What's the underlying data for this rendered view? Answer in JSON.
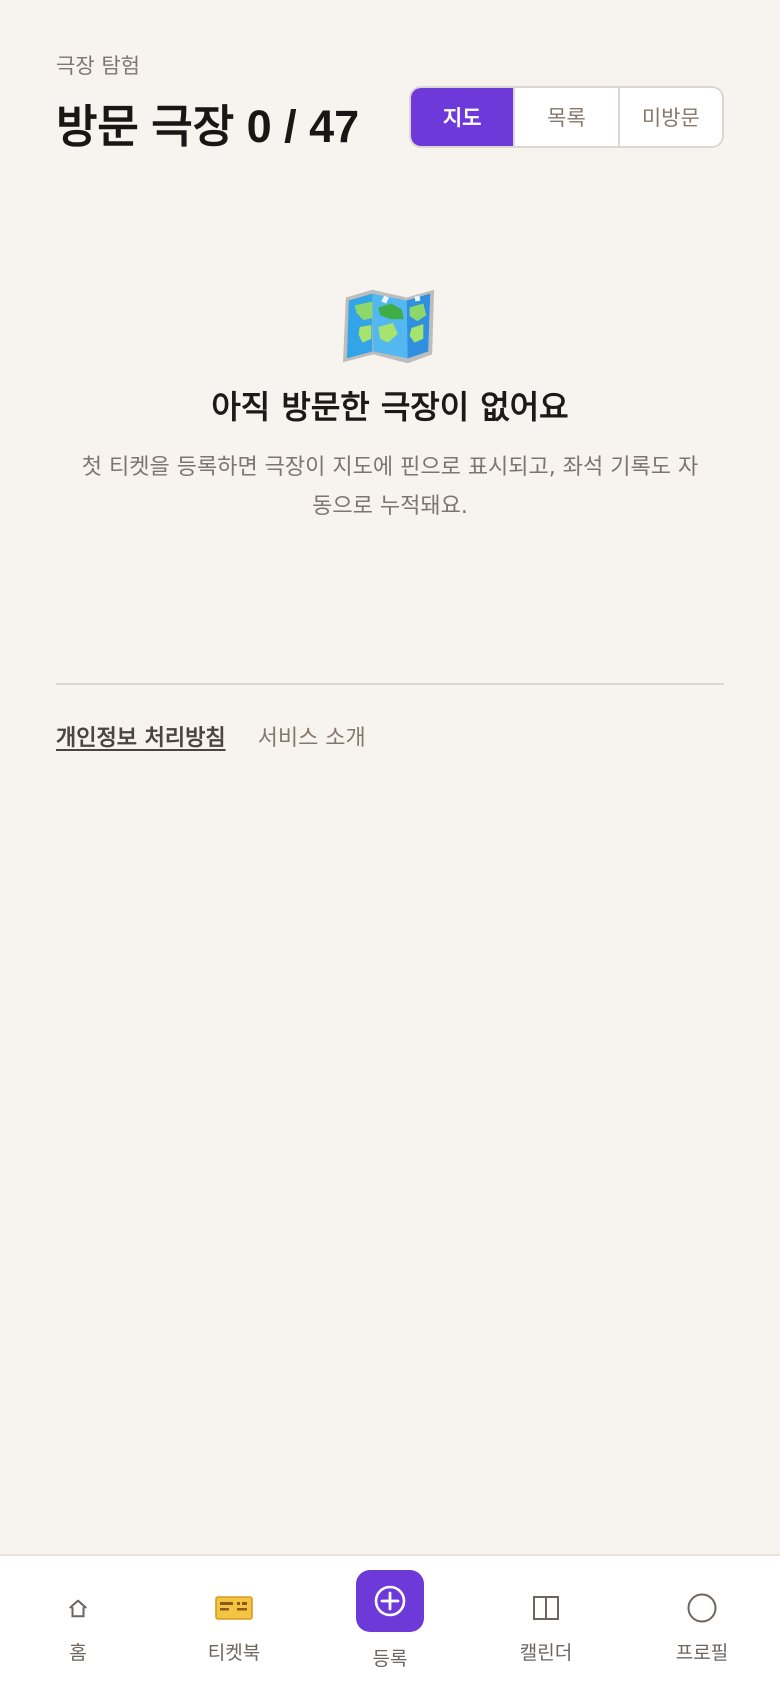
{
  "header": {
    "eyebrow": "극장 탐험",
    "title": "방문 극장 0 / 47"
  },
  "view_tabs": [
    {
      "label": "지도",
      "active": true
    },
    {
      "label": "목록",
      "active": false
    },
    {
      "label": "미방문",
      "active": false
    }
  ],
  "empty_state": {
    "icon": "world-map-icon",
    "title": "아직 방문한 극장이 없어요",
    "description": "첫 티켓을 등록하면 극장이 지도에 핀으로 표시되고, 좌석 기록도 자동으로 누적돼요."
  },
  "footer": {
    "privacy": "개인정보 처리방침",
    "about": "서비스 소개"
  },
  "bottom_nav": [
    {
      "label": "홈",
      "icon": "home-icon"
    },
    {
      "label": "티켓북",
      "icon": "ticket-icon"
    },
    {
      "label": "등록",
      "icon": "add-circle-icon"
    },
    {
      "label": "캘린더",
      "icon": "calendar-icon"
    },
    {
      "label": "프로필",
      "icon": "profile-icon"
    }
  ],
  "colors": {
    "accent": "#6d39d8",
    "background": "#f7f3ee",
    "text": "#1c1a19",
    "muted": "#7d756f"
  }
}
